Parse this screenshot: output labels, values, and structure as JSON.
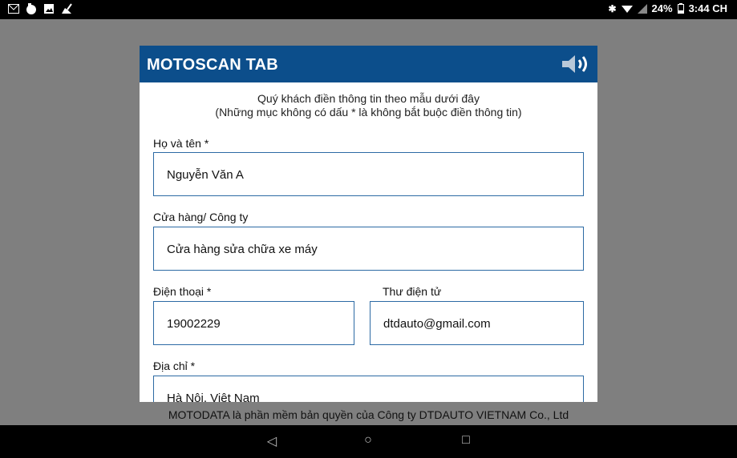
{
  "status_bar": {
    "battery": "24%",
    "time": "3:44 CH",
    "left_icons": [
      "gmail-icon",
      "app-icon",
      "image-icon",
      "broom-icon"
    ],
    "right_icons": [
      "bluetooth-icon",
      "wifi-icon",
      "signal-icon",
      "battery-icon"
    ]
  },
  "dialog": {
    "title": "MOTOSCAN TAB",
    "intro_line1": "Quý khách điền thông tin theo mẫu dưới đây",
    "intro_line2": "(Những mục không có dấu * là không bắt buộc điền thông tin)",
    "fields": {
      "name": {
        "label": "Họ và tên *",
        "value": "Nguyễn Văn A"
      },
      "company": {
        "label": "Cửa hàng/ Công ty",
        "value": "Cửa hàng sửa chữa xe máy"
      },
      "phone": {
        "label": "Điện thoại *",
        "value": "19002229"
      },
      "email": {
        "label": "Thư điện tử",
        "value": "dtdauto@gmail.com"
      },
      "address": {
        "label": "Địa chỉ *",
        "value": "Hà Nội, Việt Nam"
      }
    }
  },
  "footer": "MOTODATA là phần mềm bản quyền của Công ty DTDAUTO VIETNAM Co., Ltd",
  "nav": {
    "back": "◁",
    "home": "○",
    "recents": "□"
  },
  "colors": {
    "header": "#0c4e8b",
    "field_border": "#2c6aa4"
  }
}
